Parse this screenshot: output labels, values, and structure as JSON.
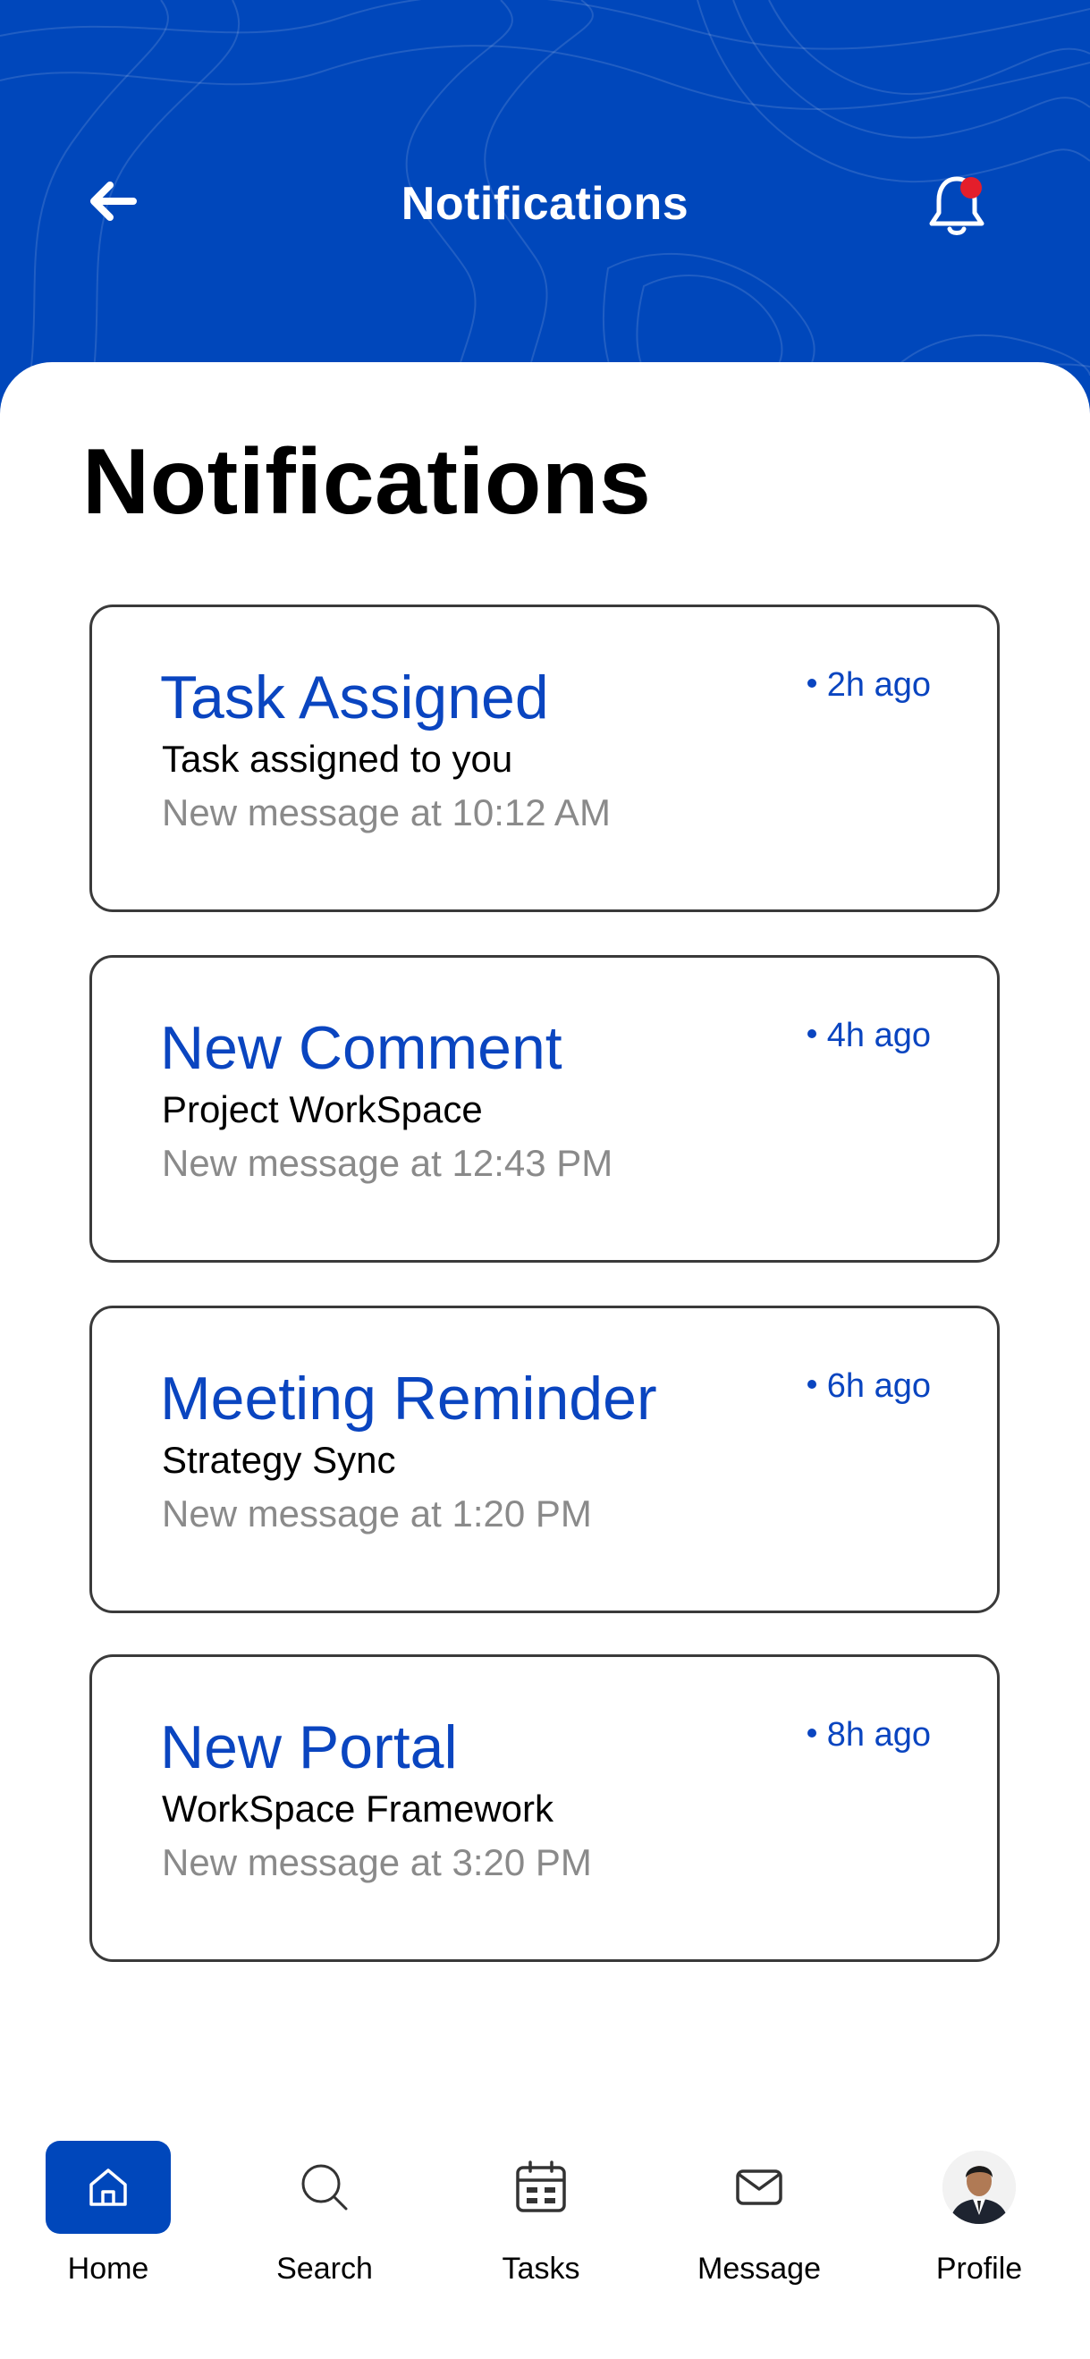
{
  "header": {
    "title": "Notifications",
    "back_icon": "arrow-left-icon",
    "bell_icon": "bell-icon",
    "has_unread_badge": true,
    "background_color": "#0047BB",
    "badge_color": "#E41E2B"
  },
  "page": {
    "title": "Notifications"
  },
  "notifications": [
    {
      "title": "Task Assigned",
      "time": "2h ago",
      "subtitle": "Task assigned to you",
      "meta": "New message at 10:12 AM"
    },
    {
      "title": "New Comment",
      "time": "4h ago",
      "subtitle": "Project WorkSpace",
      "meta": "New message at 12:43 PM"
    },
    {
      "title": "Meeting Reminder",
      "time": "6h ago",
      "subtitle": "Strategy Sync",
      "meta": "New message at 1:20 PM"
    },
    {
      "title": "New Portal",
      "time": "8h ago",
      "subtitle": "WorkSpace Framework",
      "meta": "New message at 3:20 PM"
    }
  ],
  "nav": {
    "active": "Home",
    "items": [
      {
        "label": "Home",
        "icon": "home-icon"
      },
      {
        "label": "Search",
        "icon": "search-icon"
      },
      {
        "label": "Tasks",
        "icon": "calendar-icon"
      },
      {
        "label": "Message",
        "icon": "mail-icon"
      },
      {
        "label": "Profile",
        "icon": "avatar"
      }
    ]
  },
  "colors": {
    "accent": "#0A45C0",
    "meta_text": "#8a8a8a",
    "card_border": "#3a3a3a"
  }
}
